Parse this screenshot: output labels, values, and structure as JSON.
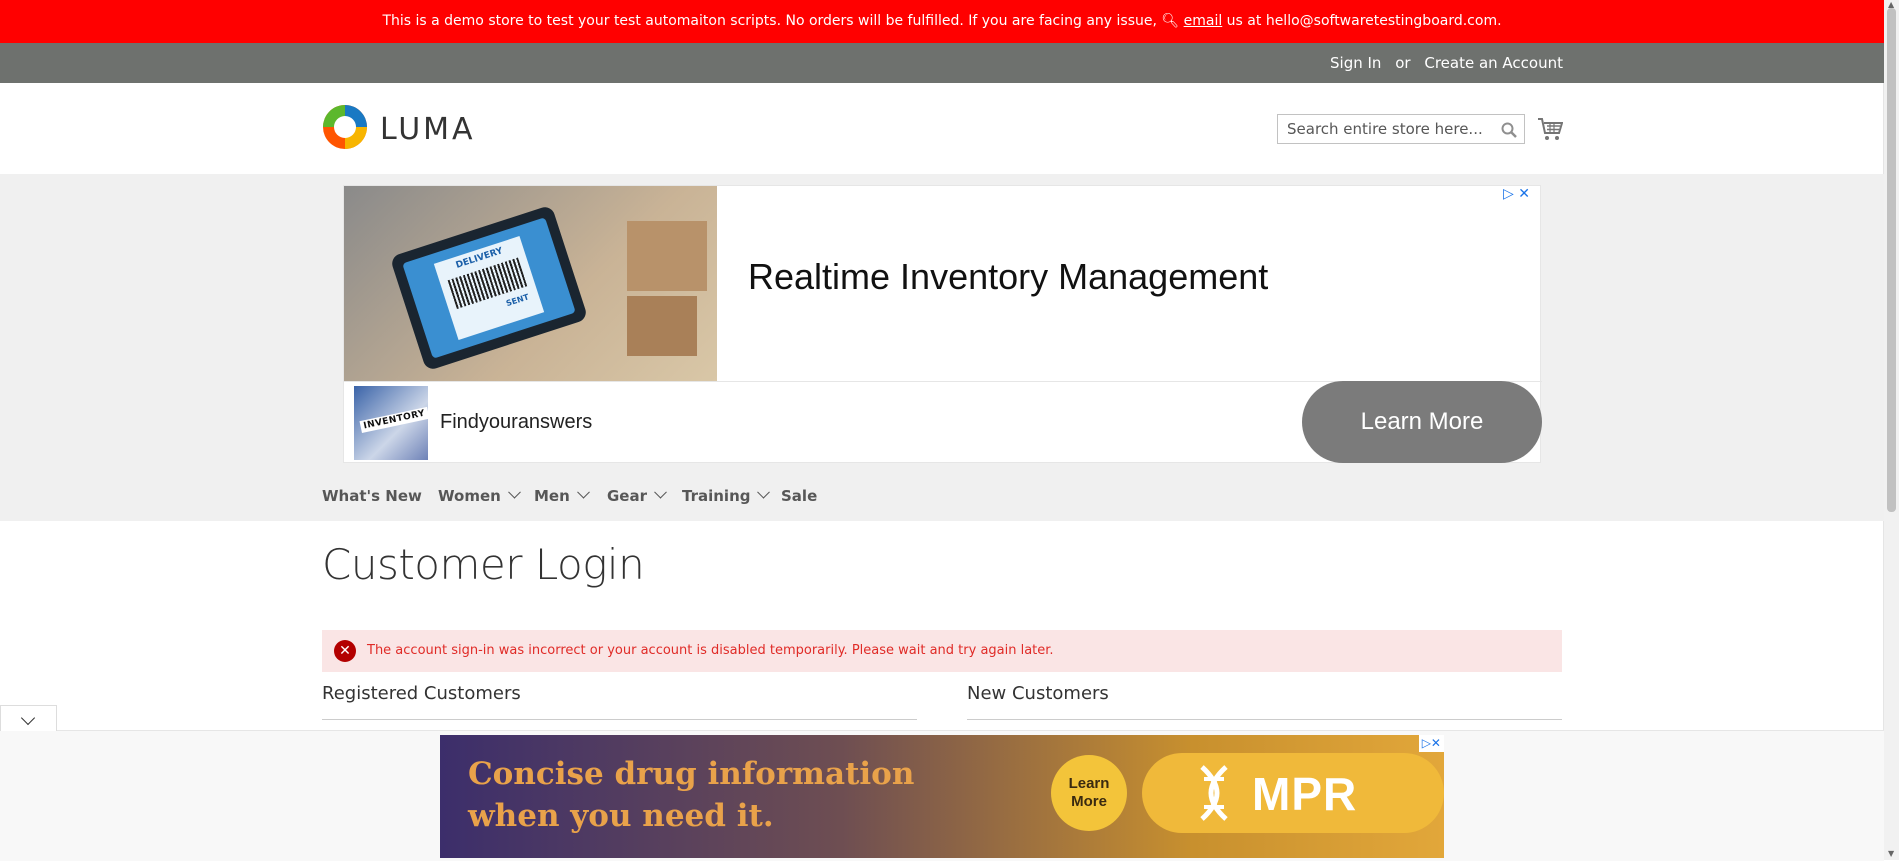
{
  "demo_notice": {
    "text_before": "This is a demo store to test your test automaiton scripts. No orders will be fulfilled. If you are facing any issue, ",
    "icon": "magnifier-icon",
    "email_link": "email",
    "text_after": " us at hello@softwaretestingboard.com."
  },
  "header": {
    "sign_in": "Sign In",
    "or": "or",
    "create_account": "Create an Account"
  },
  "logo": {
    "text": "LUMA"
  },
  "search": {
    "placeholder": "Search entire store here...",
    "value": ""
  },
  "ad_top": {
    "headline": "Realtime Inventory Management",
    "subtext": "Findyouranswers",
    "cta": "Learn More",
    "thumb_label": "INVENTORY",
    "image_text_1": "DELIVERY",
    "image_text_2": "SENT"
  },
  "nav": {
    "items": [
      {
        "label": "What's New",
        "has_children": false
      },
      {
        "label": "Women",
        "has_children": true
      },
      {
        "label": "Men",
        "has_children": true
      },
      {
        "label": "Gear",
        "has_children": true
      },
      {
        "label": "Training",
        "has_children": true
      },
      {
        "label": "Sale",
        "has_children": false
      }
    ]
  },
  "page": {
    "title": "Customer Login",
    "error": "The account sign-in was incorrect or your account is disabled temporarily. Please wait and try again later.",
    "registered_title": "Registered Customers",
    "new_title": "New Customers"
  },
  "bottom_ad": {
    "text": "Concise drug information when you need it.",
    "cta": "Learn More",
    "brand": "MPR"
  },
  "colors": {
    "notice_bg": "#ff0000",
    "header_bg": "#6e716e",
    "error_bg": "#fae5e5",
    "error_text": "#e02b27"
  }
}
